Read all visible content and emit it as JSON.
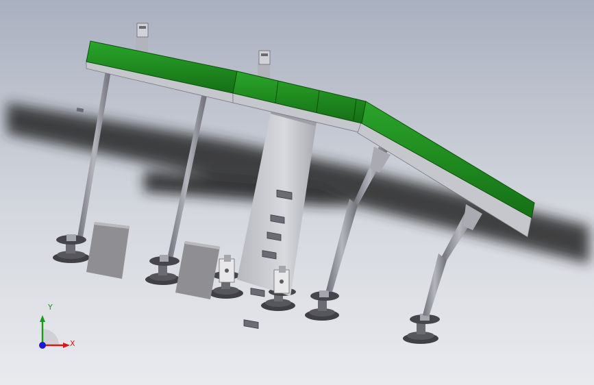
{
  "viewport": {
    "colors": {
      "belt": "#1f8f1f",
      "belt_dark": "#156b15",
      "frame": "#c9c9cc",
      "leg": "#8e8e96",
      "shadow": "#2a2a2a",
      "box": "#9a9a9a"
    }
  },
  "triad": {
    "x_label": "X",
    "y_label": "Y",
    "colors": {
      "x": "#d41a1a",
      "y": "#1a9a1a",
      "z": "#1a1ad4"
    }
  }
}
